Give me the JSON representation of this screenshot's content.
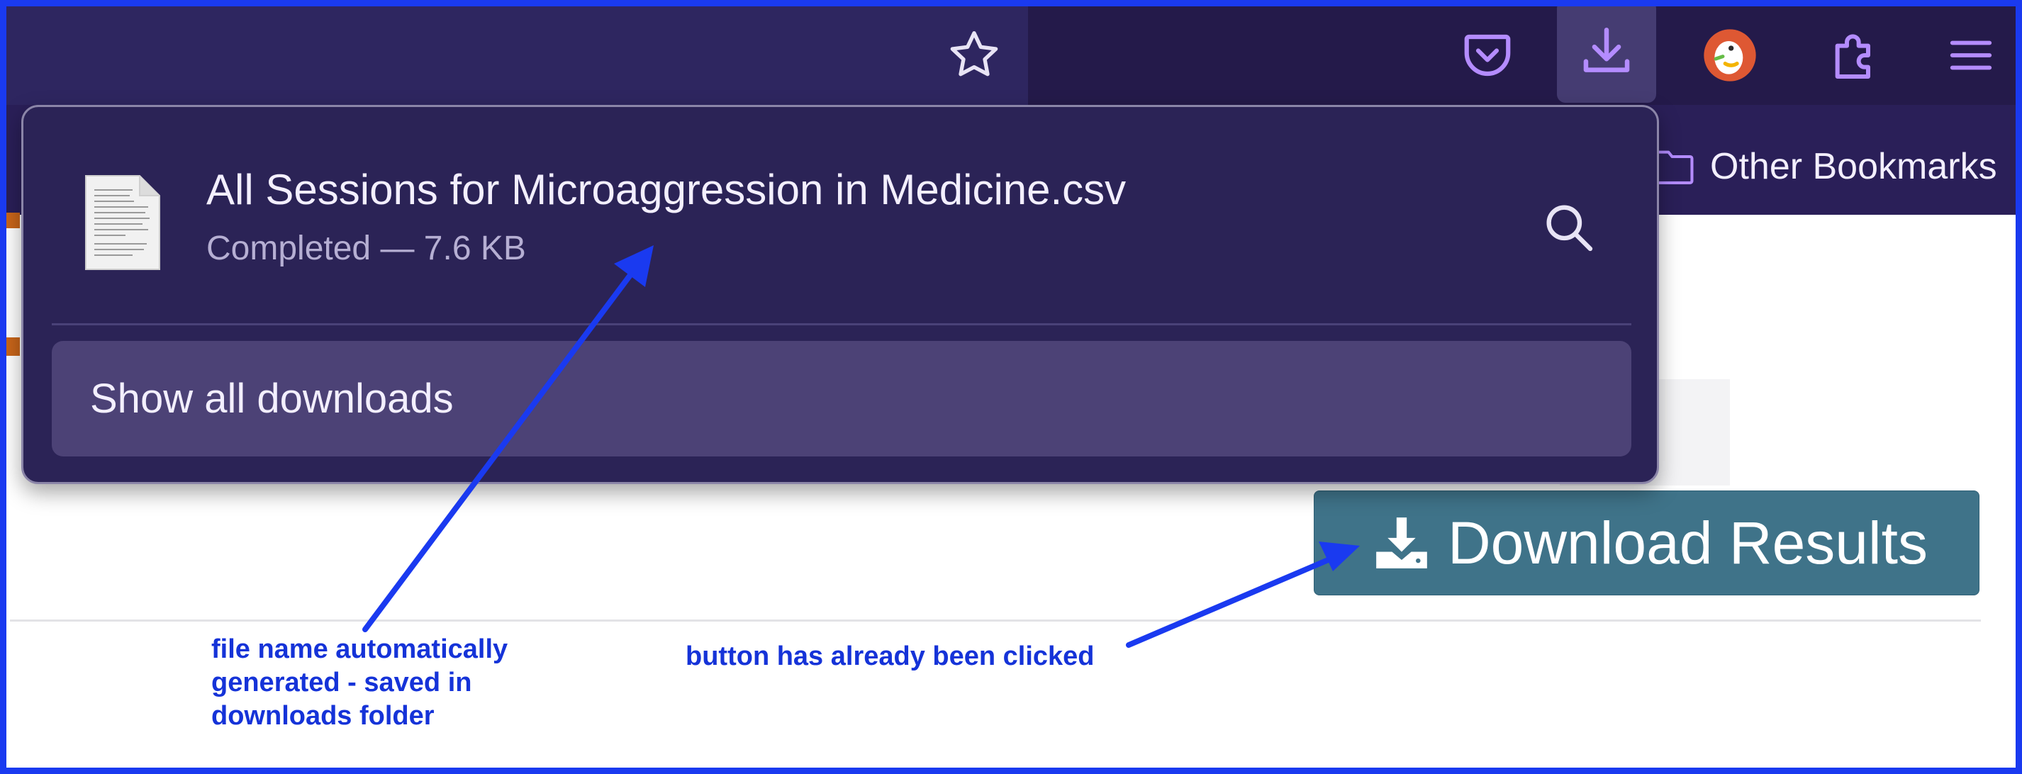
{
  "toolbar": {
    "icons": [
      "star-icon",
      "pocket-icon",
      "download-icon",
      "duckduckgo-icon",
      "extensions-icon",
      "menu-icon"
    ],
    "accent_color": "#b48cff"
  },
  "bookmarks_bar": {
    "other_bookmarks_label": "Other Bookmarks"
  },
  "downloads_panel": {
    "file_name": "All Sessions for Microaggression in Medicine.csv",
    "status": "Completed — 7.6 KB",
    "show_all_label": "Show all downloads"
  },
  "page": {
    "download_results_label": "Download Results",
    "button_color": "#3f7389"
  },
  "annotations": {
    "file_name_note": "file name automatically generated - saved in downloads folder",
    "button_note": "button has already been clicked",
    "color": "#1a3af0"
  }
}
